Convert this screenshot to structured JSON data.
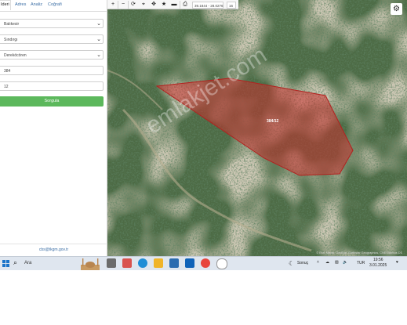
{
  "panel": {
    "tabs": [
      {
        "label": "Ideri",
        "active": true
      },
      {
        "label": "Adres"
      },
      {
        "label": "Analiz"
      },
      {
        "label": "Coğrafi"
      }
    ],
    "fields": {
      "province": "Balıkesir",
      "district": "Sındırgı",
      "neighborhood": "Dereköcören",
      "block": "384",
      "parcel": "12"
    },
    "query_button": "Sorgula",
    "email": "cbs@tkgm.gov.tr"
  },
  "toolbar": {
    "coordinates": "39.1844 - 28.0276",
    "zoom": "16"
  },
  "map": {
    "parcel_label": "384/12",
    "watermark": "emlakjet.com",
    "attribution": "© Esri, Maxar, GeoEye, Earthstar Geographics, CNES/Airbus DS"
  },
  "taskbar": {
    "search_placeholder": "Ara",
    "weather": "Sonuç",
    "language": "TUR",
    "time": "19:56",
    "date": "3.01.2025"
  },
  "colors": {
    "query_button": "#5cb85c",
    "parcel_fill": "#c8302e",
    "parcel_stroke": "#b3201e",
    "link": "#3b6ea5"
  }
}
